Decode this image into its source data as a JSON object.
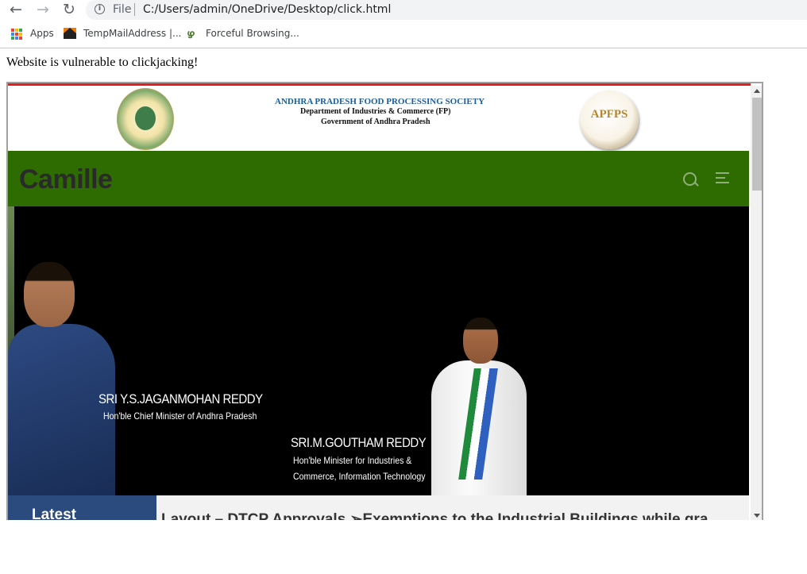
{
  "browser": {
    "nav": {
      "back_icon": "←",
      "forward_icon": "→",
      "reload_icon": "↻"
    },
    "omnibox": {
      "info_icon": "i",
      "scheme": "File",
      "url": "C:/Users/admin/OneDrive/Desktop/click.html"
    },
    "bookmarks": [
      {
        "label": "Apps"
      },
      {
        "label": "TempMailAddress |..."
      },
      {
        "label": "Forceful Browsing..."
      }
    ],
    "fb_icon_glyph": "ഴ"
  },
  "page": {
    "heading": "Website is vulnerable to clickjacking!"
  },
  "iframe": {
    "org_name": "ANDHRA PRADESH FOOD PROCESSING SOCIETY",
    "department": "Department of Industries & Commerce (FP)",
    "government": "Government of Andhra Pradesh",
    "logo_text": "APFPS",
    "brand": "Camille",
    "navbar_color": "#2e6b00",
    "banner": {
      "caption1_name": "SRI Y.S.JAGANMOHAN REDDY",
      "caption1_title": "Hon'ble Chief Minister of Andhra Pradesh",
      "caption2_name": "SRI.M.GOUTHAM REDDY",
      "caption2_title_line1": "Hon'ble Minister for Industries &",
      "caption2_title_line2": "Commerce, Information Technology"
    },
    "ticker": {
      "label": "Latest",
      "text": "Layout – DTCP Approvals       ➢Exemptions to the Industrial Buildings while gra"
    }
  },
  "colors": {
    "accent_red": "#e3201b",
    "ticker_blue": "#2b4b7e"
  }
}
